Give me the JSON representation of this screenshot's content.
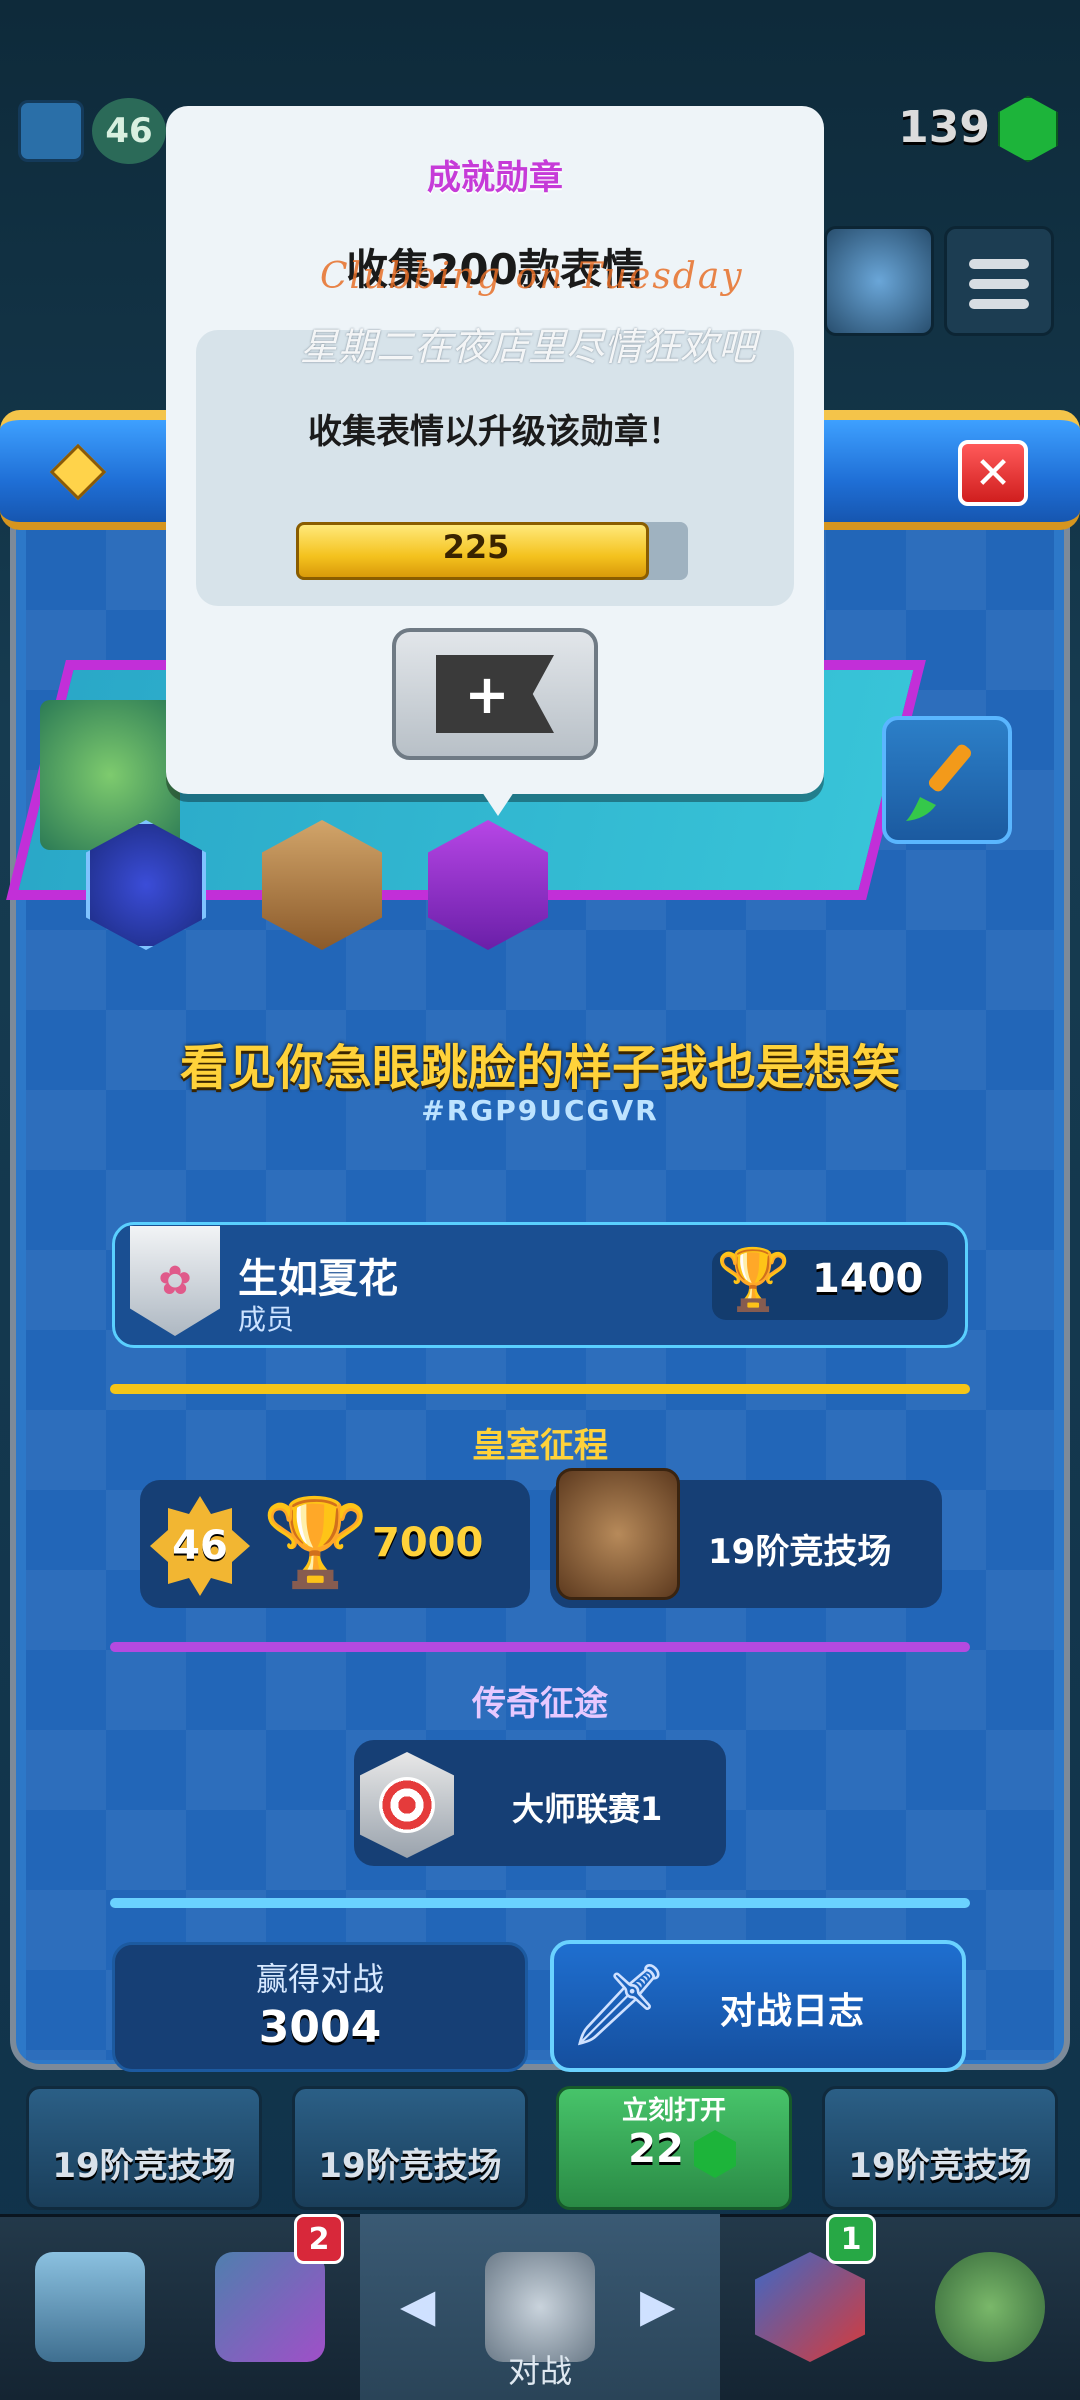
{
  "top_bar": {
    "level": "46",
    "gems": "139"
  },
  "popup": {
    "title": "成就勋章",
    "heading": "收集200款表情",
    "description": "收集表情以升级该勋章！",
    "progress_value": "225",
    "progress_fraction": 0.9,
    "overlay_text_en": "Clubbing on Tuesday",
    "overlay_text_cn": "星期二在夜店里尽情狂欢吧"
  },
  "profile": {
    "name": "看见你急眼跳脸的样子我也是想笑",
    "tag": "#RGP9UCGVR",
    "clan": {
      "name": "生如夏花",
      "role": "成员",
      "trophies": "1400"
    },
    "royal_road": {
      "title": "皇室征程",
      "level": "46",
      "trophies": "7000",
      "arena": "19阶竞技场"
    },
    "legend": {
      "title": "传奇征途",
      "league": "大师联赛1"
    },
    "stats": {
      "wins_label": "赢得对战",
      "wins_value": "3004",
      "battle_log_label": "对战日志"
    }
  },
  "chests": [
    {
      "label": "19阶竞技场"
    },
    {
      "label": "19阶竞技场"
    },
    {
      "label": "立刻打开",
      "cost": "22"
    },
    {
      "label": "19阶竞技场"
    }
  ],
  "nav": {
    "cards_badge": "2",
    "clan_badge": "1",
    "battle_label": "对战"
  },
  "colors": {
    "accent_gold": "#ffd23a",
    "popup_title": "#c63bd8",
    "royal_road_divider": "#f5c518",
    "legend_divider": "#b44ae0",
    "bottom_divider": "#6ad2ff"
  }
}
